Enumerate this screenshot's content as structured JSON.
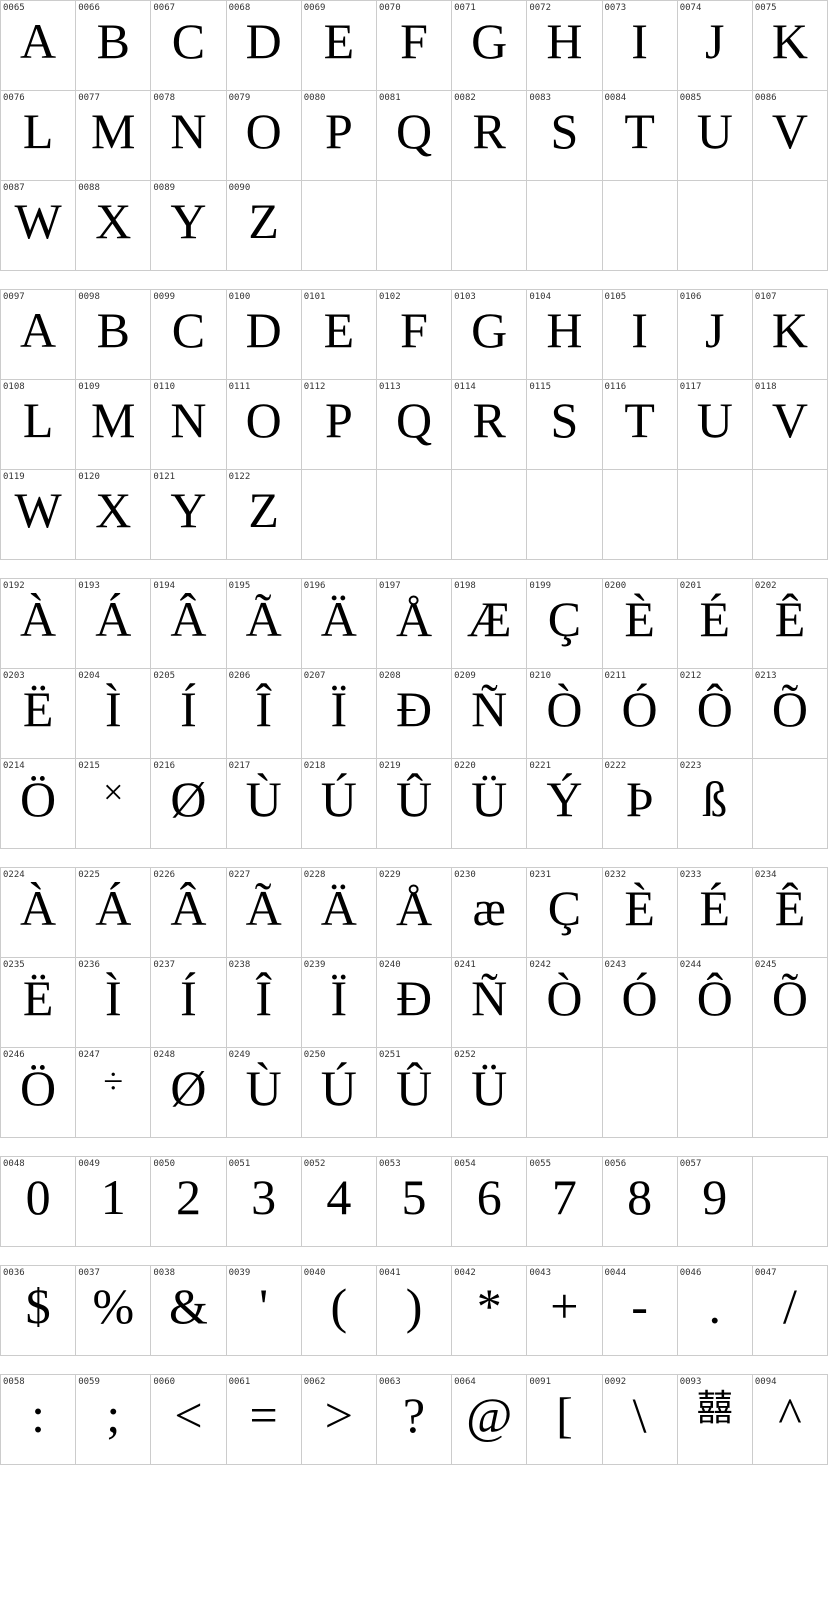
{
  "sections": [
    {
      "id": "uppercase",
      "rows": [
        [
          {
            "code": "0065",
            "label": "A",
            "char": "A"
          },
          {
            "code": "0066",
            "label": "B",
            "char": "B"
          },
          {
            "code": "0067",
            "label": "C",
            "char": "C"
          },
          {
            "code": "0068",
            "label": "D",
            "char": "D"
          },
          {
            "code": "0069",
            "label": "E",
            "char": "E"
          },
          {
            "code": "0070",
            "label": "F",
            "char": "F"
          },
          {
            "code": "0071",
            "label": "G",
            "char": "G"
          },
          {
            "code": "0072",
            "label": "H",
            "char": "H"
          },
          {
            "code": "0073",
            "label": "I",
            "char": "I"
          },
          {
            "code": "0074",
            "label": "J",
            "char": "J"
          },
          {
            "code": "0075",
            "label": "K",
            "char": "K"
          }
        ],
        [
          {
            "code": "0076",
            "label": "L",
            "char": "L"
          },
          {
            "code": "0077",
            "label": "M",
            "char": "M"
          },
          {
            "code": "0078",
            "label": "N",
            "char": "N"
          },
          {
            "code": "0079",
            "label": "O",
            "char": "O"
          },
          {
            "code": "0080",
            "label": "P",
            "char": "P"
          },
          {
            "code": "0081",
            "label": "Q",
            "char": "Q"
          },
          {
            "code": "0082",
            "label": "R",
            "char": "R"
          },
          {
            "code": "0083",
            "label": "S",
            "char": "S"
          },
          {
            "code": "0084",
            "label": "T",
            "char": "T"
          },
          {
            "code": "0085",
            "label": "U",
            "char": "U"
          },
          {
            "code": "0086",
            "label": "V",
            "char": "V"
          }
        ],
        [
          {
            "code": "0087",
            "label": "W",
            "char": "W"
          },
          {
            "code": "0088",
            "label": "X",
            "char": "X"
          },
          {
            "code": "0089",
            "label": "Y",
            "char": "Y"
          },
          {
            "code": "0090",
            "label": "Z",
            "char": "Z"
          },
          null,
          null,
          null,
          null,
          null,
          null,
          null
        ]
      ]
    },
    {
      "id": "lowercase",
      "rows": [
        [
          {
            "code": "0097",
            "label": "a",
            "char": "A"
          },
          {
            "code": "0098",
            "label": "b",
            "char": "B"
          },
          {
            "code": "0099",
            "label": "c",
            "char": "C"
          },
          {
            "code": "0100",
            "label": "d",
            "char": "D"
          },
          {
            "code": "0101",
            "label": "e",
            "char": "E"
          },
          {
            "code": "0102",
            "label": "f",
            "char": "F"
          },
          {
            "code": "0103",
            "label": "g",
            "char": "G"
          },
          {
            "code": "0104",
            "label": "h",
            "char": "H"
          },
          {
            "code": "0105",
            "label": "i",
            "char": "I"
          },
          {
            "code": "0106",
            "label": "j",
            "char": "J"
          },
          {
            "code": "0107",
            "label": "k",
            "char": "K"
          }
        ],
        [
          {
            "code": "0108",
            "label": "l",
            "char": "L"
          },
          {
            "code": "0109",
            "label": "m",
            "char": "M"
          },
          {
            "code": "0110",
            "label": "n",
            "char": "N"
          },
          {
            "code": "0111",
            "label": "o",
            "char": "O"
          },
          {
            "code": "0112",
            "label": "p",
            "char": "P"
          },
          {
            "code": "0113",
            "label": "q",
            "char": "Q"
          },
          {
            "code": "0114",
            "label": "r",
            "char": "R"
          },
          {
            "code": "0115",
            "label": "s",
            "char": "S"
          },
          {
            "code": "0116",
            "label": "t",
            "char": "T"
          },
          {
            "code": "0117",
            "label": "u",
            "char": "U"
          },
          {
            "code": "0118",
            "label": "v",
            "char": "V"
          }
        ],
        [
          {
            "code": "0119",
            "label": "w",
            "char": "W"
          },
          {
            "code": "0120",
            "label": "x",
            "char": "X"
          },
          {
            "code": "0121",
            "label": "y",
            "char": "Y"
          },
          {
            "code": "0122",
            "label": "z",
            "char": "Z"
          },
          null,
          null,
          null,
          null,
          null,
          null,
          null
        ]
      ]
    },
    {
      "id": "extended1",
      "rows": [
        [
          {
            "code": "0192",
            "label": "À",
            "char": "À"
          },
          {
            "code": "0193",
            "label": "Á",
            "char": "Á"
          },
          {
            "code": "0194",
            "label": "Â",
            "char": "Â"
          },
          {
            "code": "0195",
            "label": "Ã",
            "char": "Ã"
          },
          {
            "code": "0196",
            "label": "Ä",
            "char": "Ä"
          },
          {
            "code": "0197",
            "label": "Å",
            "char": "Å"
          },
          {
            "code": "0198",
            "label": "Æ",
            "char": "Æ"
          },
          {
            "code": "0199",
            "label": "Ç",
            "char": "Ç"
          },
          {
            "code": "0200",
            "label": "È",
            "char": "È"
          },
          {
            "code": "0201",
            "label": "É",
            "char": "É"
          },
          {
            "code": "0202",
            "label": "Ê",
            "char": "Ê"
          }
        ],
        [
          {
            "code": "0203",
            "label": "Ë",
            "char": "Ë"
          },
          {
            "code": "0204",
            "label": "Ì",
            "char": "Ì"
          },
          {
            "code": "0205",
            "label": "Í",
            "char": "Í"
          },
          {
            "code": "0206",
            "label": "Î",
            "char": "Î"
          },
          {
            "code": "0207",
            "label": "Ï",
            "char": "Ï"
          },
          {
            "code": "0208",
            "label": "Ð",
            "char": "Ð"
          },
          {
            "code": "0209",
            "label": "Ñ",
            "char": "Ñ"
          },
          {
            "code": "0210",
            "label": "Ò",
            "char": "Ò"
          },
          {
            "code": "0211",
            "label": "Ó",
            "char": "Ó"
          },
          {
            "code": "0212",
            "label": "Ô",
            "char": "Ô"
          },
          {
            "code": "0213",
            "label": "Õ",
            "char": "Õ"
          }
        ],
        [
          {
            "code": "0214",
            "label": "Ö",
            "char": "Ö"
          },
          {
            "code": "0215",
            "label": "×",
            "char": "×"
          },
          {
            "code": "0216",
            "label": "Ø",
            "char": "Ø"
          },
          {
            "code": "0217",
            "label": "Ù",
            "char": "Ù"
          },
          {
            "code": "0218",
            "label": "Ú",
            "char": "Ú"
          },
          {
            "code": "0219",
            "label": "Û",
            "char": "Û"
          },
          {
            "code": "0220",
            "label": "Ü",
            "char": "Ü"
          },
          {
            "code": "0221",
            "label": "Ý",
            "char": "Ý"
          },
          {
            "code": "0222",
            "label": "Þ",
            "char": "Þ"
          },
          {
            "code": "0223",
            "label": "ß",
            "char": "ß"
          },
          null
        ]
      ]
    },
    {
      "id": "extended2",
      "rows": [
        [
          {
            "code": "0224",
            "label": "à",
            "char": "À"
          },
          {
            "code": "0225",
            "label": "á",
            "char": "Á"
          },
          {
            "code": "0226",
            "label": "â",
            "char": "Â"
          },
          {
            "code": "0227",
            "label": "ã",
            "char": "Ã"
          },
          {
            "code": "0228",
            "label": "ä",
            "char": "Ä"
          },
          {
            "code": "0229",
            "label": "å",
            "char": "Å"
          },
          {
            "code": "0230",
            "label": "æ",
            "char": "Æ"
          },
          {
            "code": "0231",
            "label": "ç",
            "char": "Ç"
          },
          {
            "code": "0232",
            "label": "è",
            "char": "È"
          },
          {
            "code": "0233",
            "label": "é",
            "char": "É"
          },
          {
            "code": "0234",
            "label": "ê",
            "char": "Ê"
          }
        ],
        [
          {
            "code": "0235",
            "label": "ë",
            "char": "Ë"
          },
          {
            "code": "0236",
            "label": "ì",
            "char": "Ì"
          },
          {
            "code": "0237",
            "label": "í",
            "char": "Í"
          },
          {
            "code": "0238",
            "label": "î",
            "char": "Î"
          },
          {
            "code": "0239",
            "label": "ï",
            "char": "Ï"
          },
          {
            "code": "0240",
            "label": "ð",
            "char": "Ð"
          },
          {
            "code": "0241",
            "label": "ñ",
            "char": "Ñ"
          },
          {
            "code": "0242",
            "label": "ò",
            "char": "Ò"
          },
          {
            "code": "0243",
            "label": "ó",
            "char": "Ó"
          },
          {
            "code": "0244",
            "label": "ô",
            "char": "Ô"
          },
          {
            "code": "0245",
            "label": "õ",
            "char": "Õ"
          }
        ],
        [
          {
            "code": "0246",
            "label": "ö",
            "char": "Ö"
          },
          {
            "code": "0247",
            "label": "÷",
            "char": "÷"
          },
          {
            "code": "0248",
            "label": "ø",
            "char": "Ø"
          },
          {
            "code": "0249",
            "label": "ù",
            "char": "Ù"
          },
          {
            "code": "0250",
            "label": "ú",
            "char": "Ú"
          },
          {
            "code": "0251",
            "label": "û",
            "char": "Û"
          },
          {
            "code": "0252",
            "label": "ü",
            "char": "Ü"
          },
          null,
          null,
          null,
          null
        ]
      ]
    },
    {
      "id": "digits",
      "rows": [
        [
          {
            "code": "0048",
            "label": "0",
            "char": "0"
          },
          {
            "code": "0049",
            "label": "1",
            "char": "1"
          },
          {
            "code": "0050",
            "label": "2",
            "char": "2"
          },
          {
            "code": "0051",
            "label": "3",
            "char": "3"
          },
          {
            "code": "0052",
            "label": "4",
            "char": "4"
          },
          {
            "code": "0053",
            "label": "5",
            "char": "5"
          },
          {
            "code": "0054",
            "label": "6",
            "char": "6"
          },
          {
            "code": "0055",
            "label": "7",
            "char": "7"
          },
          {
            "code": "0056",
            "label": "8",
            "char": "8"
          },
          {
            "code": "0057",
            "label": "9",
            "char": "9"
          },
          null
        ]
      ]
    },
    {
      "id": "symbols1",
      "rows": [
        [
          {
            "code": "0036",
            "label": "$",
            "char": "$"
          },
          {
            "code": "0037",
            "label": "%",
            "char": "%"
          },
          {
            "code": "0038",
            "label": "&",
            "char": "&"
          },
          {
            "code": "0039",
            "label": "'",
            "char": "'"
          },
          {
            "code": "0040",
            "label": "(",
            "char": "("
          },
          {
            "code": "0041",
            "label": ")",
            "char": ")"
          },
          {
            "code": "0042",
            "label": "*",
            "char": "*"
          },
          {
            "code": "0043",
            "label": "+",
            "char": "+"
          },
          {
            "code": "0044",
            "label": "-",
            "char": "-"
          },
          {
            "code": "0046",
            "label": ".",
            "char": "."
          },
          {
            "code": "0047",
            "label": "/",
            "char": "/"
          }
        ]
      ]
    },
    {
      "id": "symbols2",
      "rows": [
        [
          {
            "code": "0058",
            "label": ":",
            "char": ":"
          },
          {
            "code": "0059",
            "label": ";",
            "char": ";"
          },
          {
            "code": "0060",
            "label": "<",
            "char": "<"
          },
          {
            "code": "0061",
            "label": "=",
            "char": "="
          },
          {
            "code": "0062",
            "label": ">",
            "char": ">"
          },
          {
            "code": "0063",
            "label": "?",
            "char": "?"
          },
          {
            "code": "0064",
            "label": "@",
            "char": "@"
          },
          {
            "code": "0091",
            "label": "[",
            "char": "["
          },
          {
            "code": "0092",
            "label": "\\",
            "char": "\\"
          },
          {
            "code": "0093",
            "label": "]",
            "char": "喜"
          },
          {
            "code": "0094",
            "label": "^",
            "char": "^"
          }
        ]
      ]
    }
  ]
}
